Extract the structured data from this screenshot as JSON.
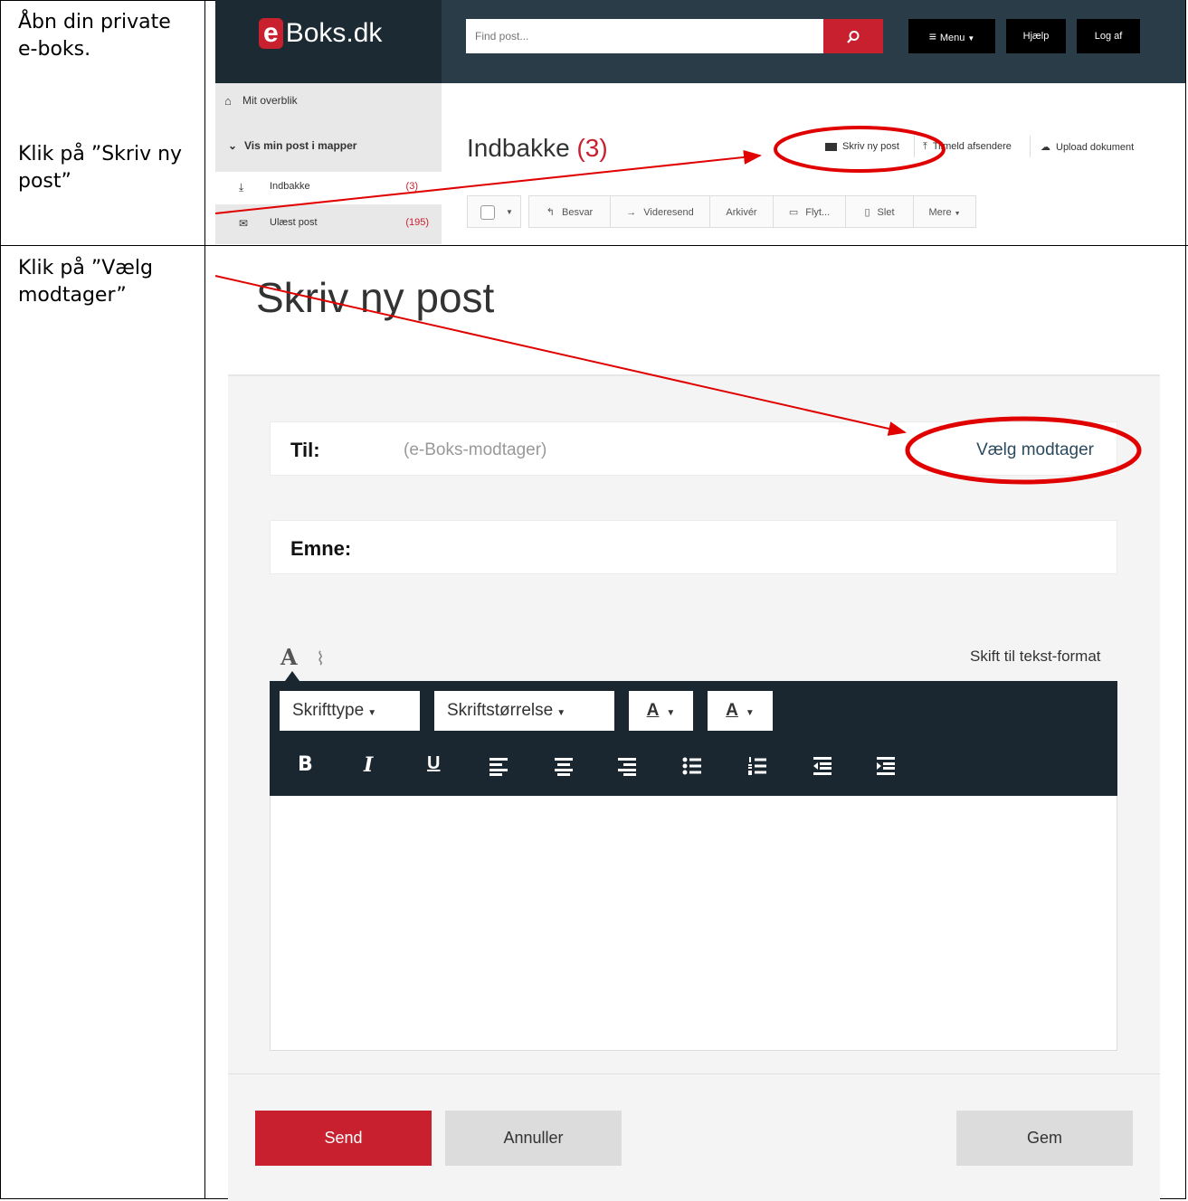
{
  "steps": [
    {
      "instruction": "Åbn din private e-boks."
    },
    {
      "instruction": "Klik på ”Skriv ny post”"
    },
    {
      "instruction": "Klik på ”Vælg modtager”"
    }
  ],
  "inbox": {
    "logo_e": "e",
    "logo_text": "Boks.dk",
    "search_placeholder": "Find post...",
    "menu_label": "Menu",
    "help_label": "Hjælp",
    "logout_label": "Log af",
    "sidebar": {
      "overview": "Mit overblik",
      "folders": "Vis min post i mapper",
      "items": [
        {
          "label": "Indbakke",
          "count": "(3)"
        },
        {
          "label": "Ulæst post",
          "count": "(195)"
        }
      ]
    },
    "title": "Indbakke",
    "title_count": "(3)",
    "actions": {
      "compose": "Skriv ny post",
      "subscribe": "Tilmeld afsendere",
      "upload": "Upload dokument"
    },
    "toolbar": [
      "Besvar",
      "Videresend",
      "Arkivér",
      "Flyt...",
      "Slet",
      "Mere"
    ]
  },
  "compose": {
    "heading": "Skriv ny post",
    "to_label": "Til:",
    "to_placeholder": "(e-Boks-modtager)",
    "choose_recipient": "Vælg modtager",
    "subject_label": "Emne:",
    "switch_format": "Skift til tekst-format",
    "font_type": "Skrifttype",
    "font_size": "Skriftstørrelse",
    "font_color": "A",
    "highlight_color": "A",
    "format_buttons": {
      "bold": "B",
      "italic": "I",
      "underline": "U"
    },
    "send": "Send",
    "cancel": "Annuller",
    "save": "Gem"
  },
  "colors": {
    "brand_red": "#c8202f",
    "header_dark": "#2a3c47",
    "editor_bar": "#1a2730",
    "annotation_red": "#e00000"
  }
}
